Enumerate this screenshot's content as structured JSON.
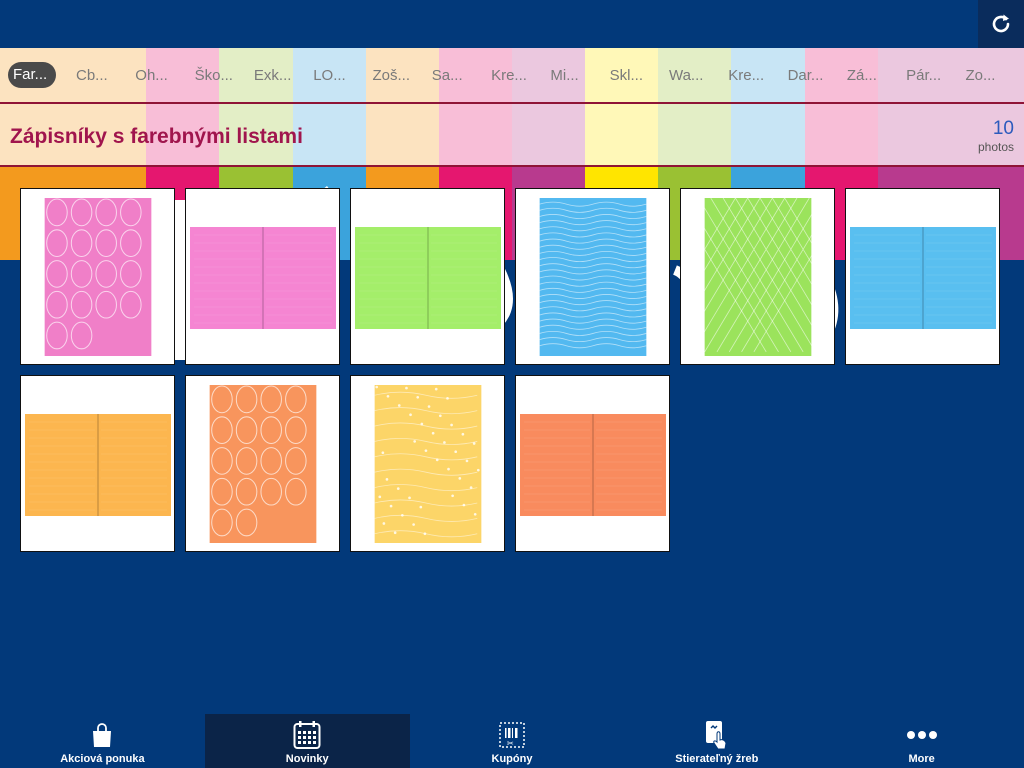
{
  "colors": {
    "background": "#02397a",
    "title": "#a0154d",
    "count": "#2c5bbd",
    "stripes": [
      "#f39a1e",
      "#f39a1e",
      "#e5176f",
      "#9ac133",
      "#3ba3dc",
      "#f39a1e",
      "#e5176f",
      "#b83a8e",
      "#ffe500",
      "#9ac133",
      "#3ba3dc",
      "#e5176f",
      "#b83a8e",
      "#b83a8e"
    ]
  },
  "toolbar": {
    "refresh_icon": "refresh-icon"
  },
  "categories": [
    "Far...",
    "Cb...",
    "Oh...",
    "Ško...",
    "Exk...",
    "LO...",
    "Zoš...",
    "Sa...",
    "Kre...",
    "Mi...",
    "Skl...",
    "Wa...",
    "Kre...",
    "Dar...",
    "Zá...",
    "Pár...",
    "Zo..."
  ],
  "active_category": 0,
  "album": {
    "title": "Zápisníky s farebnými listami",
    "count": "10",
    "count_label": "photos"
  },
  "photos": [
    {
      "color": "#f07fc8",
      "style": "closed-pattern"
    },
    {
      "color": "#f585d2",
      "style": "open"
    },
    {
      "color": "#a4ee6a",
      "style": "open"
    },
    {
      "color": "#53b9f0",
      "style": "closed-waves"
    },
    {
      "color": "#9be35c",
      "style": "closed-lattice"
    },
    {
      "color": "#59bff0",
      "style": "open"
    },
    {
      "color": "#fcb64f",
      "style": "open"
    },
    {
      "color": "#f8955d",
      "style": "closed-pattern"
    },
    {
      "color": "#fcd568",
      "style": "closed-dots"
    },
    {
      "color": "#f98b5e",
      "style": "open"
    }
  ],
  "bottom_tabs": [
    {
      "label": "Akciová ponuka",
      "icon": "shopping-bag-icon"
    },
    {
      "label": "Novinky",
      "icon": "calendar-icon"
    },
    {
      "label": "Kupóny",
      "icon": "coupon-icon"
    },
    {
      "label": "Stierateľný žreb",
      "icon": "scratch-card-icon"
    },
    {
      "label": "More",
      "icon": "more-icon"
    }
  ],
  "active_bottom_tab": 1
}
